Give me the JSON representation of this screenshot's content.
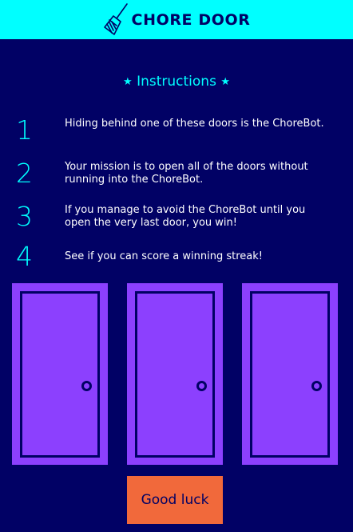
{
  "header": {
    "title": "CHORE DOOR",
    "logo_icon": "broom-icon"
  },
  "instructions": {
    "title": "Instructions",
    "star": "★",
    "steps": [
      {
        "number": "1",
        "text": "Hiding behind one of these doors is the ChoreBot."
      },
      {
        "number": "2",
        "text": "Your mission is to open all of the doors without running into the ChoreBot."
      },
      {
        "number": "3",
        "text": "If you manage to avoid the ChoreBot until you open the very last door, you win!"
      },
      {
        "number": "4",
        "text": "See if you can score a winning streak!"
      }
    ]
  },
  "doors": [
    {
      "state": "closed"
    },
    {
      "state": "closed"
    },
    {
      "state": "closed"
    }
  ],
  "start_button": {
    "label": "Good luck"
  },
  "colors": {
    "background": "#010165",
    "accent": "#00ffff",
    "door": "#8c40fe",
    "button": "#f1693b"
  }
}
